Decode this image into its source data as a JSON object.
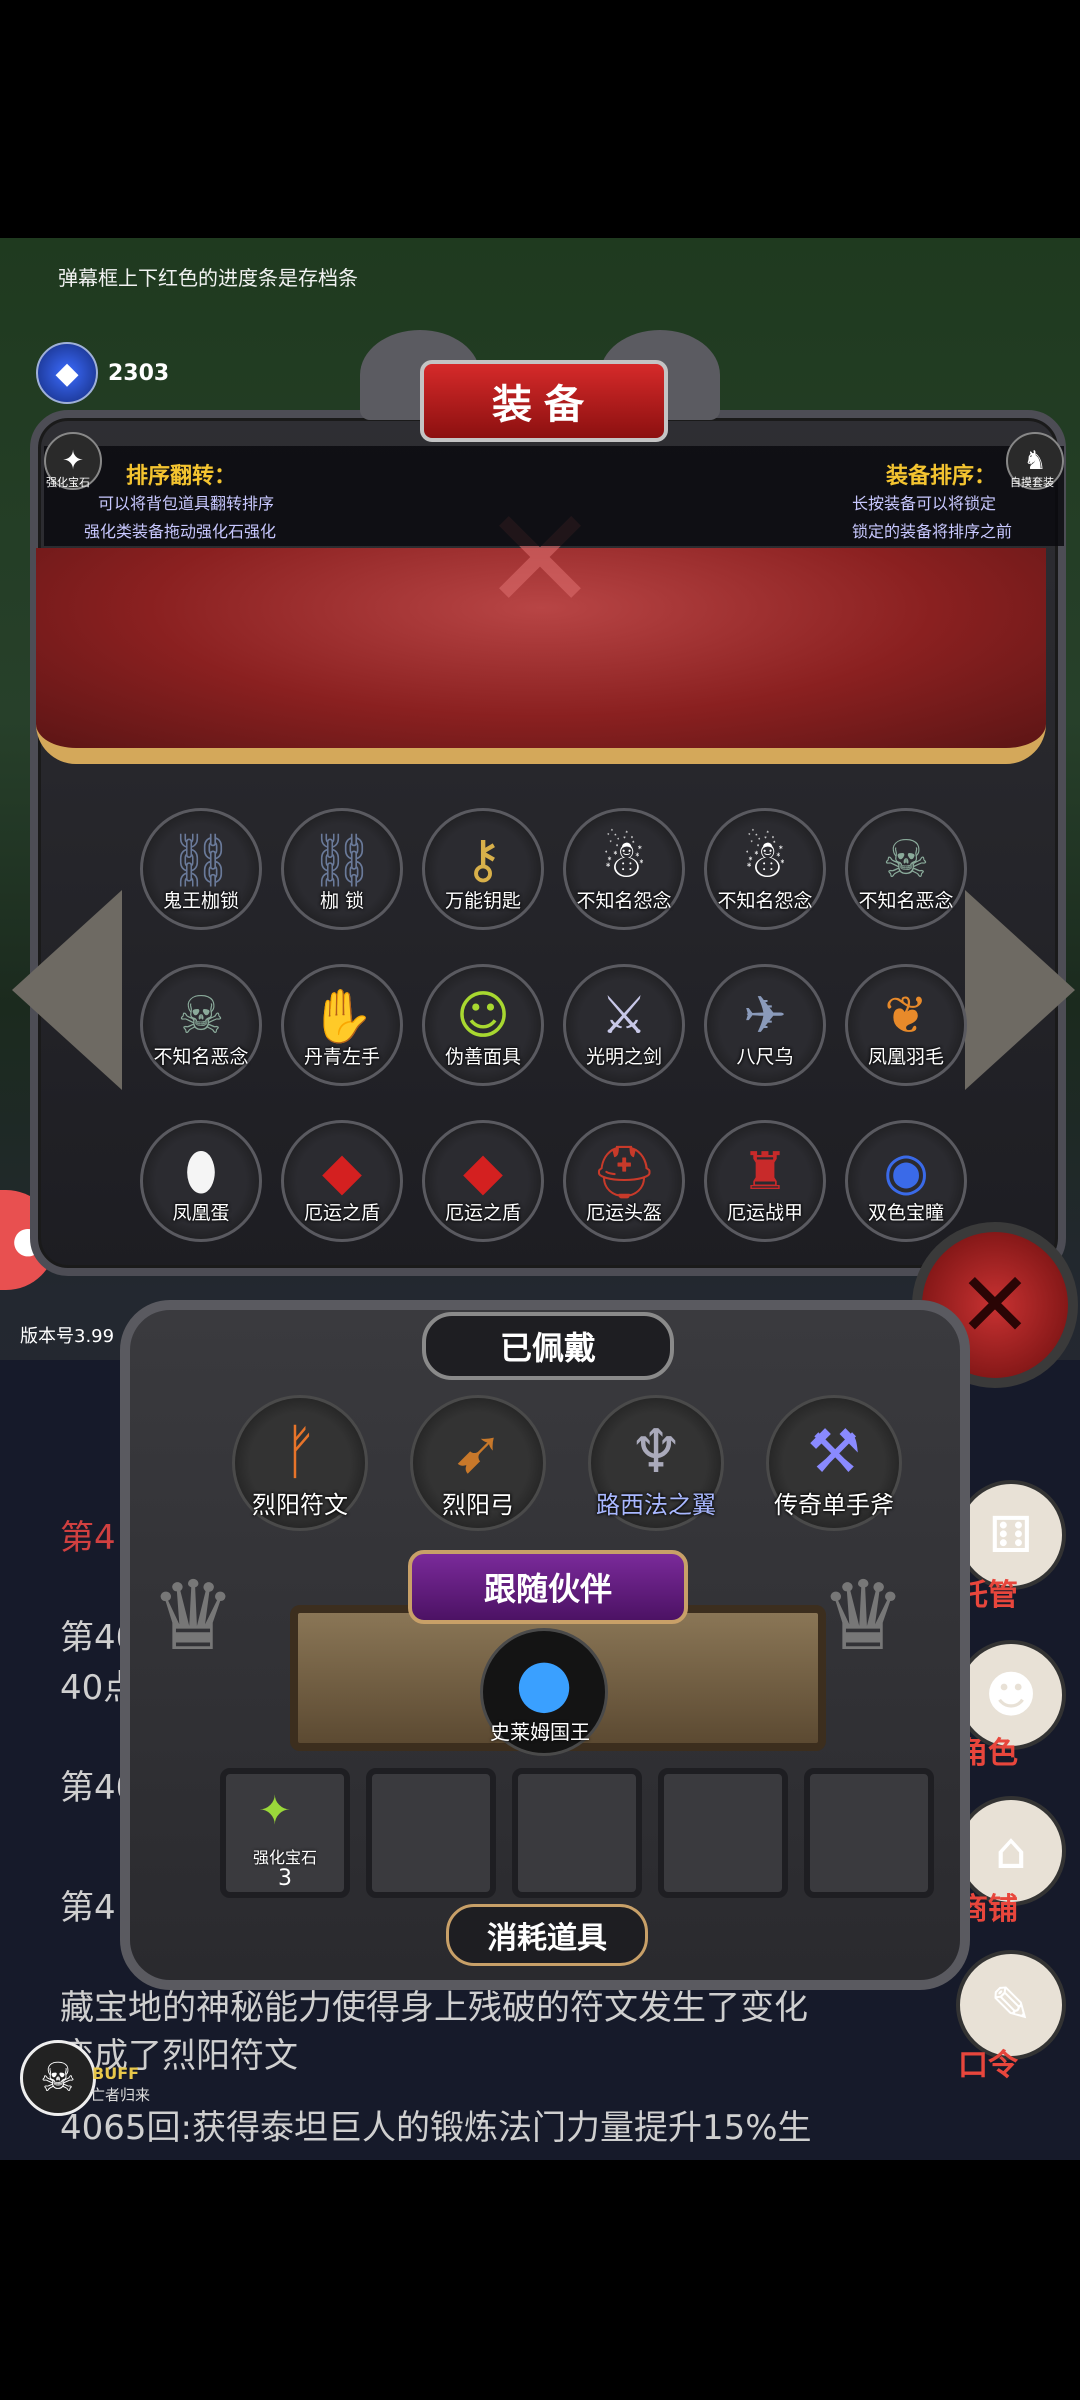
{
  "hint_text": "弹幕框上下红色的进度条是存档条",
  "gem": {
    "icon": "blue-gem-icon",
    "label": "宝石",
    "value": "2303"
  },
  "title": "装备",
  "info_left": {
    "icon_label": "强化宝石",
    "title": "排序翻转：",
    "line1": "可以将背包道具翻转排序",
    "line2": "强化类装备拖动强化石强化"
  },
  "info_right": {
    "icon_label": "自摸套装",
    "title": "装备排序：",
    "line1": "长按装备可以将锁定",
    "line2": "锁定的装备将排序之前"
  },
  "items": [
    {
      "name": "鬼王枷锁",
      "icon": "chain-icon"
    },
    {
      "name": "枷 锁",
      "icon": "chain-icon"
    },
    {
      "name": "万能钥匙",
      "icon": "key-icon"
    },
    {
      "name": "不知名怨念",
      "icon": "ghost-icon"
    },
    {
      "name": "不知名怨念",
      "icon": "ghost-icon"
    },
    {
      "name": "不知名恶念",
      "icon": "specter-icon"
    },
    {
      "name": "不知名恶念",
      "icon": "specter-icon"
    },
    {
      "name": "丹青左手",
      "icon": "glove-icon"
    },
    {
      "name": "伪善面具",
      "icon": "mask-icon"
    },
    {
      "name": "光明之剑",
      "icon": "sword-icon"
    },
    {
      "name": "八尺乌",
      "icon": "crow-icon"
    },
    {
      "name": "凤凰羽毛",
      "icon": "feather-icon"
    },
    {
      "name": "凤凰蛋",
      "icon": "egg-icon"
    },
    {
      "name": "厄运之盾",
      "icon": "red-shard-icon"
    },
    {
      "name": "厄运之盾",
      "icon": "red-shard-icon"
    },
    {
      "name": "厄运头盔",
      "icon": "helmet-icon"
    },
    {
      "name": "厄运战甲",
      "icon": "armor-icon"
    },
    {
      "name": "双色宝瞳",
      "icon": "amulet-icon"
    }
  ],
  "version": "版本号3.99",
  "equipped": {
    "title": "已佩戴",
    "items": [
      {
        "name": "烈阳符文",
        "icon": "rune-icon",
        "special": false
      },
      {
        "name": "烈阳弓",
        "icon": "bow-icon",
        "special": false
      },
      {
        "name": "路西法之翼",
        "icon": "wings-icon",
        "special": true
      },
      {
        "name": "传奇单手斧",
        "icon": "axe-icon",
        "special": false
      }
    ]
  },
  "companion": {
    "title": "跟随伙伴",
    "name": "史莱姆国王",
    "icon": "slime-icon"
  },
  "consumables": {
    "title": "消耗道具",
    "slots": [
      {
        "name": "强化宝石",
        "count": "3",
        "icon": "green-gem-icon"
      },
      {
        "name": "",
        "count": "",
        "icon": ""
      },
      {
        "name": "",
        "count": "",
        "icon": ""
      },
      {
        "name": "",
        "count": "",
        "icon": ""
      },
      {
        "name": "",
        "count": "",
        "icon": ""
      }
    ]
  },
  "log": {
    "l1": "第4",
    "l2": "第40",
    "l3": "40点",
    "l4": "第40",
    "l5": "第4",
    "l6": "藏宝地的神秘能力使得身上残破的符文发生了变化",
    "l7": "变成了烈阳符文",
    "l8": "4065回:获得泰坦巨人的锻炼法门力量提升15%生"
  },
  "side_buttons": [
    {
      "label": "托管",
      "icon": "dice-icon"
    },
    {
      "label": "角色",
      "icon": "hooded-figure-icon"
    },
    {
      "label": "商铺",
      "icon": "shop-icon"
    },
    {
      "label": "口令",
      "icon": "scroll-icon"
    }
  ],
  "buff": {
    "label": "BUFF",
    "sub": "亡者归来"
  }
}
